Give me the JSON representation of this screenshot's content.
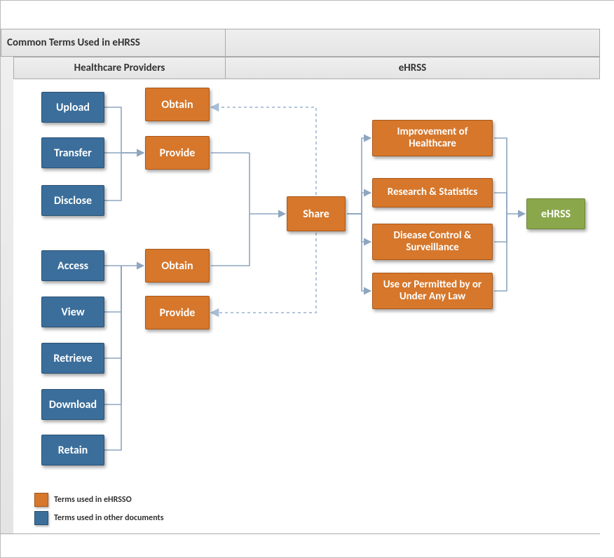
{
  "title": "Common Terms Used in eHRSS",
  "columns": {
    "left": "Healthcare Providers",
    "right": "eHRSS"
  },
  "left_group1": [
    "Upload",
    "Transfer",
    "Disclose"
  ],
  "left_group2": [
    "Access",
    "View",
    "Retrieve",
    "Download",
    "Retain"
  ],
  "mid": {
    "obtain1": "Obtain",
    "provide1": "Provide",
    "obtain2": "Obtain",
    "provide2": "Provide"
  },
  "share": "Share",
  "purposes": [
    "Improvement of Healthcare",
    "Research & Statistics",
    "Disease Control & Surveillance",
    "Use or Permitted by or Under Any Law"
  ],
  "endpoint": "eHRSS",
  "legend": {
    "orange": "Terms used in eHRSSO",
    "blue": "Terms used in other documents"
  }
}
